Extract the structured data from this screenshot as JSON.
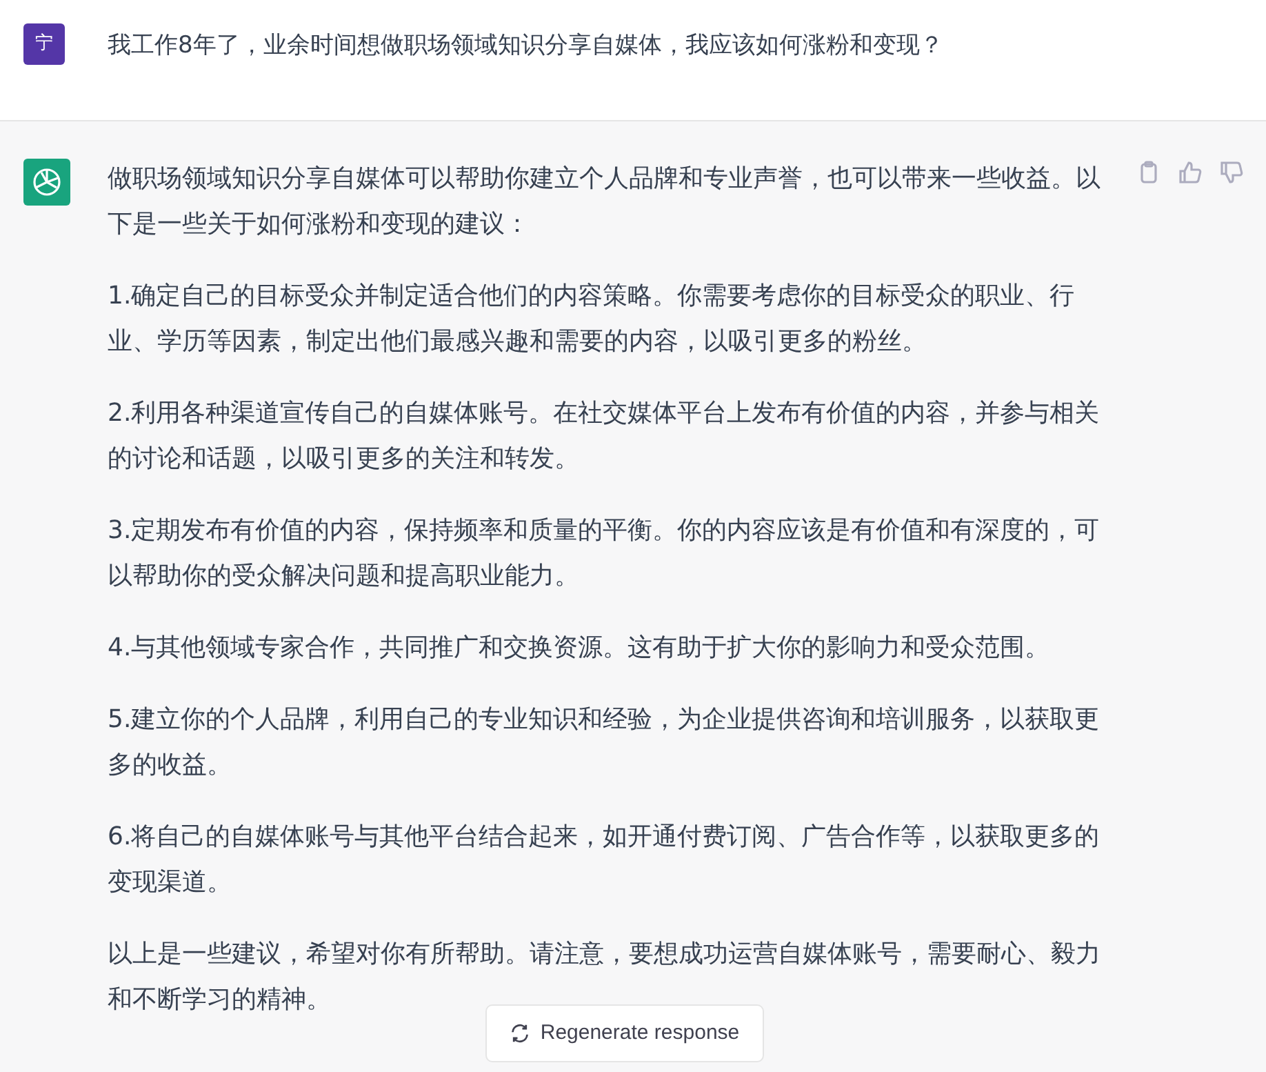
{
  "user_message": {
    "avatar": "宁",
    "text": "我工作8年了，业余时间想做职场领域知识分享自媒体，我应该如何涨粉和变现？"
  },
  "assistant_message": {
    "paragraphs": [
      "做职场领域知识分享自媒体可以帮助你建立个人品牌和专业声誉，也可以带来一些收益。以下是一些关于如何涨粉和变现的建议：",
      "1.确定自己的目标受众并制定适合他们的内容策略。你需要考虑你的目标受众的职业、行业、学历等因素，制定出他们最感兴趣和需要的内容，以吸引更多的粉丝。",
      "2.利用各种渠道宣传自己的自媒体账号。在社交媒体平台上发布有价值的内容，并参与相关的讨论和话题，以吸引更多的关注和转发。",
      "3.定期发布有价值的内容，保持频率和质量的平衡。你的内容应该是有价值和有深度的，可以帮助你的受众解决问题和提高职业能力。",
      "4.与其他领域专家合作，共同推广和交换资源。这有助于扩大你的影响力和受众范围。",
      "5.建立你的个人品牌，利用自己的专业知识和经验，为企业提供咨询和培训服务，以获取更多的收益。",
      "6.将自己的自媒体账号与其他平台结合起来，如开通付费订阅、广告合作等，以获取更多的变现渠道。",
      "以上是一些建议，希望对你有所帮助。请注意，要想成功运营自媒体账号，需要耐心、毅力和不断学习的精神。"
    ]
  },
  "regenerate_button": {
    "label": "Regenerate response"
  }
}
